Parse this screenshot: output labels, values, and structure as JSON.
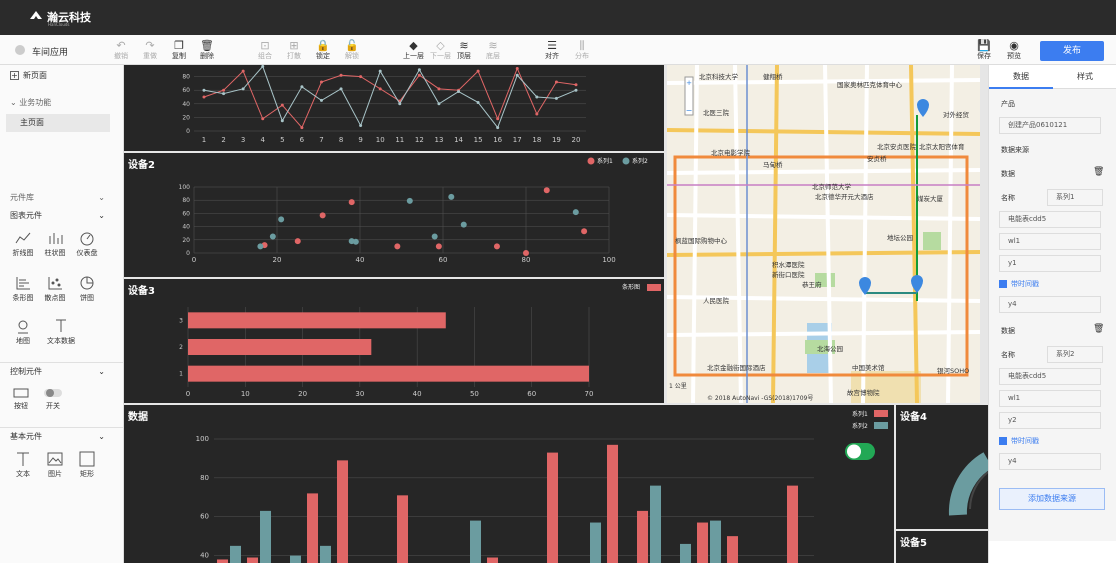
{
  "app": {
    "brand": "瀚云科技",
    "brand_sub": "HanClouds",
    "name": "车间应用"
  },
  "toolbar": [
    {
      "label": "撤销",
      "icon": "↶",
      "on": false,
      "x": 114
    },
    {
      "label": "重做",
      "icon": "↷",
      "on": false,
      "x": 143
    },
    {
      "label": "复制",
      "icon": "❐",
      "on": true,
      "x": 172
    },
    {
      "label": "删除",
      "icon": "🗑",
      "on": true,
      "x": 200
    },
    {
      "label": "组合",
      "icon": "⊡",
      "on": false,
      "x": 258
    },
    {
      "label": "打散",
      "icon": "⊞",
      "on": false,
      "x": 287
    },
    {
      "label": "锁定",
      "icon": "🔒",
      "on": true,
      "x": 316
    },
    {
      "label": "解锁",
      "icon": "🔓",
      "on": false,
      "x": 345
    },
    {
      "label": "上一层",
      "icon": "◆",
      "on": true,
      "x": 403
    },
    {
      "label": "下一层",
      "icon": "◇",
      "on": false,
      "x": 430
    },
    {
      "label": "顶层",
      "icon": "≋",
      "on": true,
      "x": 457
    },
    {
      "label": "底层",
      "icon": "≋",
      "on": false,
      "x": 486
    },
    {
      "label": "对齐",
      "icon": "☰",
      "on": true,
      "x": 545
    },
    {
      "label": "分布",
      "icon": "⫼",
      "on": false,
      "x": 575
    },
    {
      "label": "保存",
      "icon": "💾",
      "on": true,
      "x": 977
    },
    {
      "label": "预览",
      "icon": "◉",
      "on": true,
      "x": 1007
    }
  ],
  "publish": "发布",
  "left": {
    "new_page": "新页面",
    "business": "业务功能",
    "home": "主页面",
    "component_lib": "元件库",
    "chart_components": "图表元件",
    "charts": [
      "折线图",
      "柱状图",
      "仪表盘",
      "条形图",
      "散点图",
      "饼图",
      "地图",
      "文本数据"
    ],
    "control_components": "控制元件",
    "controls": [
      "按钮",
      "开关"
    ],
    "basic_components": "基本元件",
    "basics": [
      "文本",
      "图片",
      "矩形"
    ]
  },
  "canvas": {
    "device2": "设备2",
    "device3": "设备3",
    "data_panel": "数据",
    "device4": "设备4",
    "device5": "设备5",
    "legend1": "系列1",
    "legend2": "系列2",
    "legend_bar": "条形图"
  },
  "map": {
    "labels": [
      "北京科技大学",
      "健翔桥",
      "国家奥林匹克体育中心",
      "北医三院",
      "对外经贸",
      "北京电影学院",
      "北京安贞医院",
      "北京太阳宫体育",
      "马甸桥",
      "安贞桥",
      "北京师范大学",
      "北京德华开元大酒店",
      "煤炭大厦",
      "枫蓝国际购物中心",
      "积水潭医院",
      "新街口医院",
      "地坛公园",
      "人民医院",
      "恭王府",
      "中国美术馆",
      "北京金融街国际酒店",
      "北海公园",
      "故宫博物院",
      "银河SOHO",
      "1 公里"
    ],
    "copyright": "© 2018 AutoNavi -GS(2018)1709号"
  },
  "right": {
    "tab_data": "数据",
    "tab_style": "样式",
    "product": "产品",
    "product_value": "创建产品0610121",
    "source": "数据来源",
    "data": "数据",
    "name1": "名称",
    "series1": "系列1",
    "field1": "电能表cdd5",
    "wl1": "wl1",
    "y1": "y1",
    "time1": "带时间戳",
    "y4a": "y4",
    "data2": "数据",
    "name2": "名称",
    "series2": "系列2",
    "field2": "电能表cdd5",
    "wl2": "wl1",
    "y2": "y2",
    "time2": "带时间戳",
    "y4b": "y4",
    "add": "添加数据来源"
  },
  "chart_data": [
    {
      "type": "line",
      "title": "",
      "x": [
        1,
        2,
        3,
        4,
        5,
        6,
        7,
        8,
        9,
        10,
        11,
        12,
        13,
        14,
        15,
        16,
        17,
        18,
        19,
        20
      ],
      "ylim": [
        0,
        100
      ],
      "yticks": [
        0,
        20,
        40,
        60,
        80,
        100
      ],
      "series": [
        {
          "name": "",
          "color": "#e06666",
          "values": [
            50,
            60,
            88,
            18,
            38,
            5,
            72,
            82,
            80,
            62,
            44,
            82,
            62,
            60,
            88,
            18,
            92,
            25,
            72,
            68
          ]
        },
        {
          "name": "",
          "color": "#a8c4c8",
          "values": [
            60,
            55,
            62,
            95,
            15,
            65,
            45,
            62,
            8,
            88,
            40,
            90,
            40,
            58,
            42,
            5,
            82,
            50,
            48,
            60
          ]
        }
      ]
    },
    {
      "type": "scatter",
      "title": "设备2",
      "xlim": [
        0,
        100
      ],
      "ylim": [
        0,
        100
      ],
      "xticks": [
        0,
        20,
        40,
        60,
        80,
        100
      ],
      "yticks": [
        0,
        20,
        40,
        60,
        80,
        100
      ],
      "series": [
        {
          "name": "系列1",
          "color": "#e06666",
          "points": [
            [
              17,
              12
            ],
            [
              25,
              18
            ],
            [
              31,
              57
            ],
            [
              38,
              77
            ],
            [
              49,
              10
            ],
            [
              59,
              10
            ],
            [
              73,
              10
            ],
            [
              80,
              0
            ],
            [
              85,
              95
            ],
            [
              94,
              33
            ]
          ]
        },
        {
          "name": "系列2",
          "color": "#6b9ca0",
          "points": [
            [
              16,
              10
            ],
            [
              19,
              25
            ],
            [
              21,
              51
            ],
            [
              38,
              18
            ],
            [
              39,
              17
            ],
            [
              52,
              79
            ],
            [
              58,
              25
            ],
            [
              62,
              85
            ],
            [
              65,
              43
            ],
            [
              92,
              62
            ]
          ]
        }
      ]
    },
    {
      "type": "bar",
      "orientation": "horizontal",
      "title": "设备3",
      "categories": [
        "1",
        "2",
        "3"
      ],
      "values": [
        70,
        32,
        45
      ],
      "xlim": [
        0,
        70
      ],
      "xticks": [
        0,
        10,
        20,
        30,
        40,
        50,
        60,
        70
      ],
      "legend": "条形图",
      "color": "#e06666"
    },
    {
      "type": "bar",
      "title": "数据",
      "ylim": [
        30,
        100
      ],
      "yticks": [
        40,
        60,
        80,
        100
      ],
      "series": [
        {
          "name": "系列1",
          "color": "#e06666",
          "values": [
            38,
            39,
            0,
            72,
            89,
            0,
            71,
            32,
            30,
            39,
            0,
            93,
            0,
            97,
            63,
            28,
            57,
            50,
            0,
            76
          ]
        },
        {
          "name": "系列2",
          "color": "#6b9ca0",
          "values": [
            45,
            63,
            40,
            45,
            0,
            0,
            36,
            0,
            58,
            0,
            33,
            0,
            57,
            0,
            76,
            46,
            58,
            31,
            0,
            0
          ]
        }
      ]
    }
  ]
}
